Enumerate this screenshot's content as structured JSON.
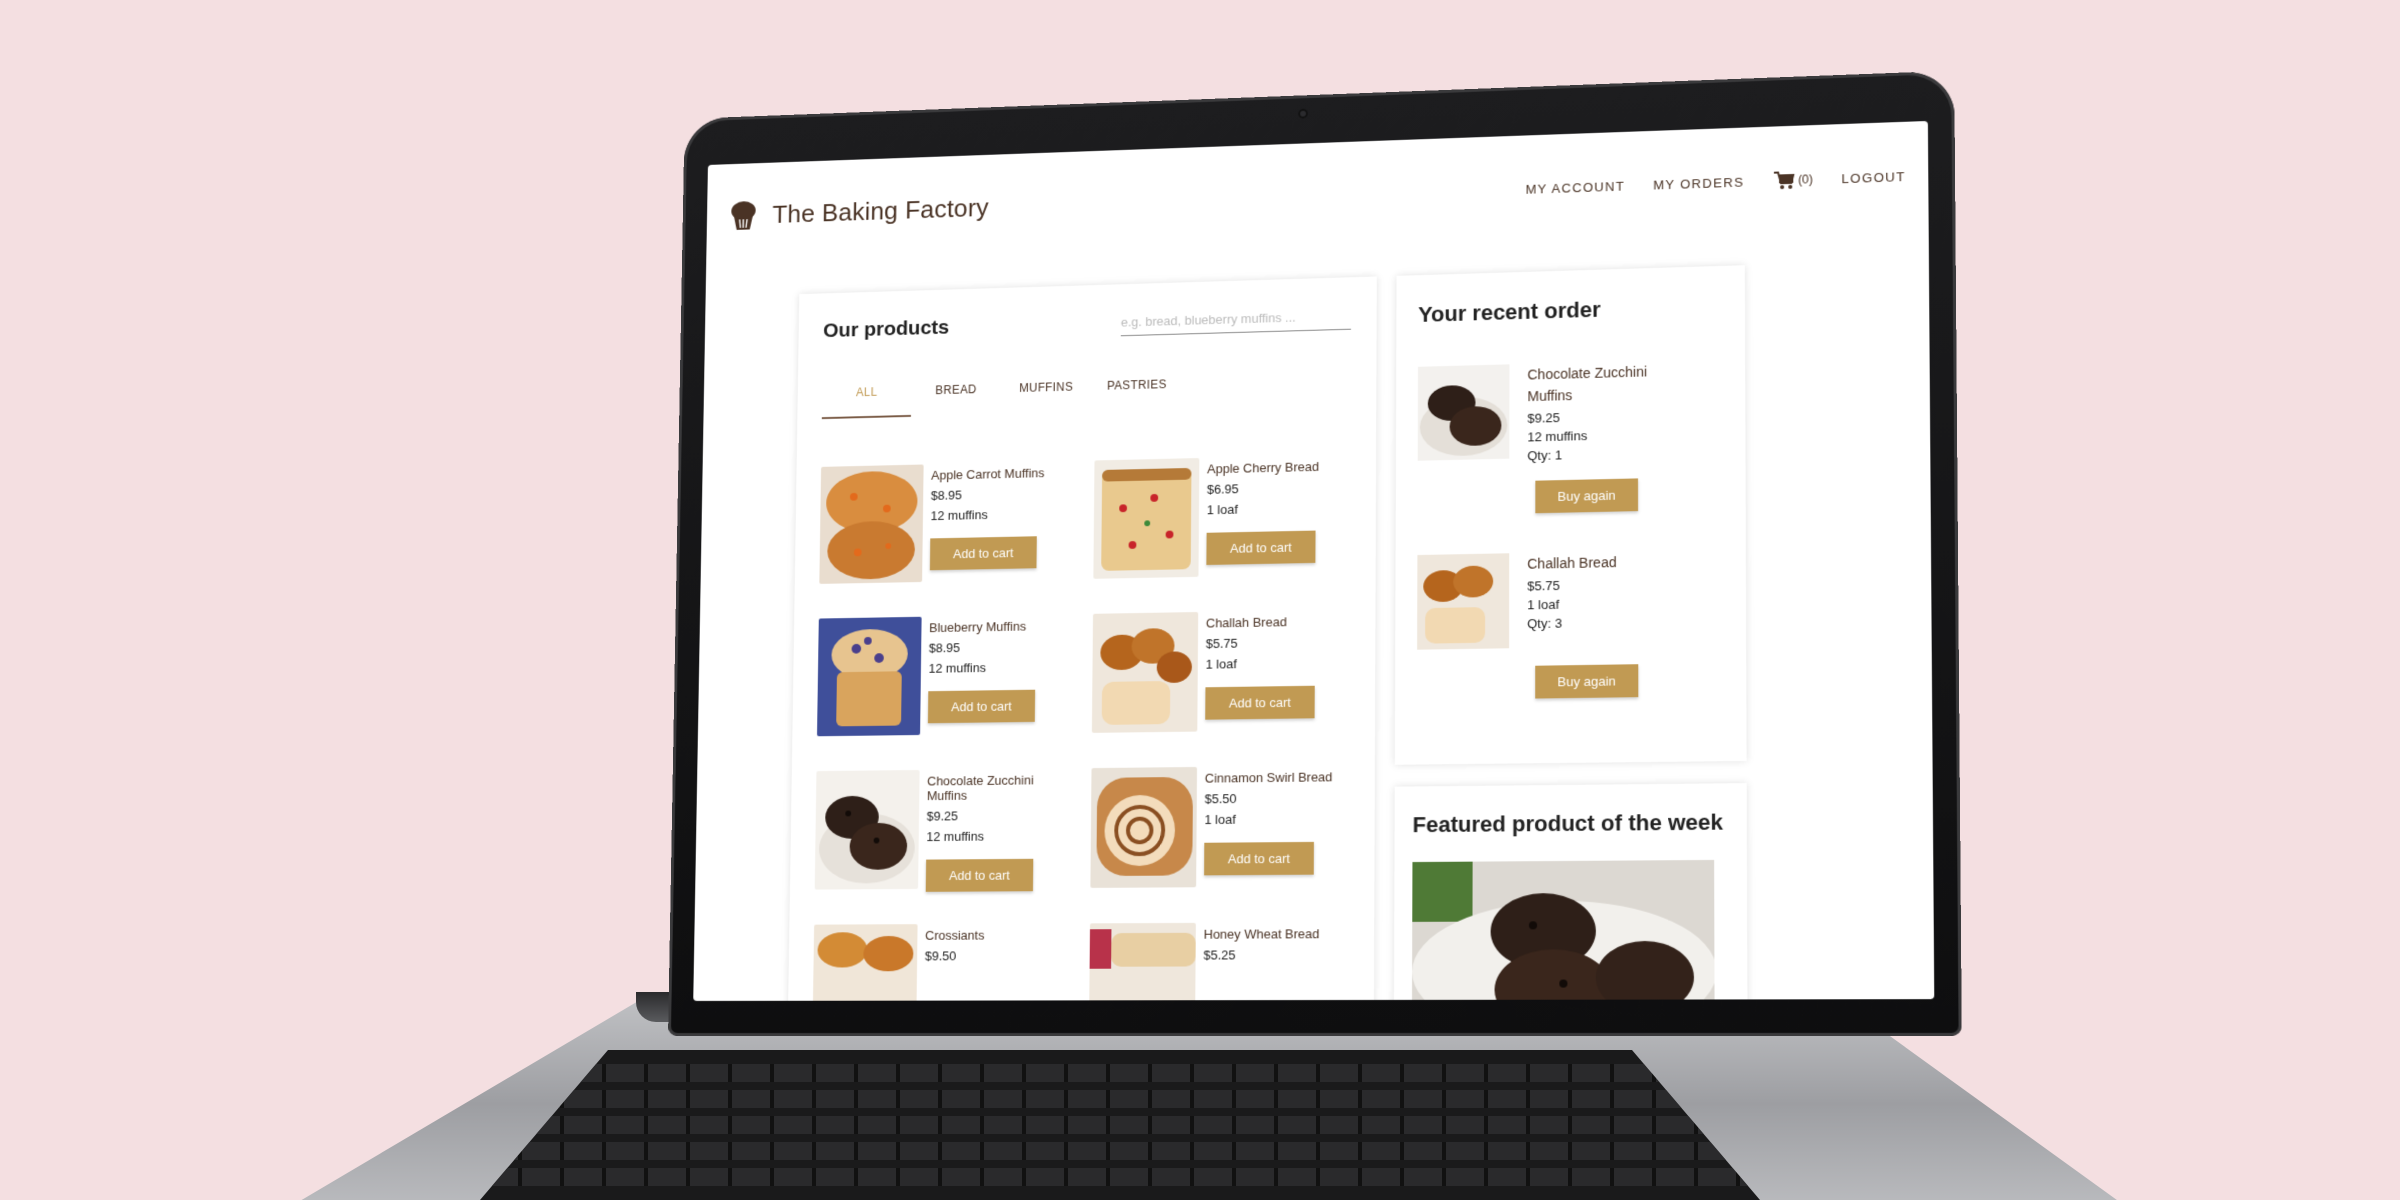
{
  "brand": {
    "name": "The Baking Factory",
    "primary_color": "#4a3325",
    "accent_color": "#c19a53",
    "logo_icon": "muffin-icon"
  },
  "nav": {
    "my_account": "MY ACCOUNT",
    "my_orders": "MY ORDERS",
    "cart_icon": "cart-icon",
    "cart_count": "(0)",
    "logout": "LOGOUT"
  },
  "products": {
    "title": "Our products",
    "search_placeholder": "e.g. bread, blueberry muffins ...",
    "tabs": [
      {
        "label": "ALL",
        "active": true
      },
      {
        "label": "BREAD",
        "active": false
      },
      {
        "label": "MUFFINS",
        "active": false
      },
      {
        "label": "PASTRIES",
        "active": false
      }
    ],
    "items": [
      {
        "name": "Apple Carrot Muffins",
        "price": "$8.95",
        "qty": "12 muffins",
        "button": "Add to cart"
      },
      {
        "name": "Apple Cherry Bread",
        "price": "$6.95",
        "qty": "1 loaf",
        "button": "Add to cart"
      },
      {
        "name": "Blueberry Muffins",
        "price": "$8.95",
        "qty": "12 muffins",
        "button": "Add to cart"
      },
      {
        "name": "Challah Bread",
        "price": "$5.75",
        "qty": "1 loaf",
        "button": "Add to cart"
      },
      {
        "name": "Chocolate Zucchini Muffins",
        "price": "$9.25",
        "qty": "12 muffins",
        "button": "Add to cart"
      },
      {
        "name": "Cinnamon Swirl Bread",
        "price": "$5.50",
        "qty": "1 loaf",
        "button": "Add to cart"
      },
      {
        "name": "Crossiants",
        "price": "$9.50",
        "qty": "",
        "button": ""
      },
      {
        "name": "Honey Wheat Bread",
        "price": "$5.25",
        "qty": "",
        "button": ""
      }
    ]
  },
  "recent_order": {
    "title": "Your recent order",
    "items": [
      {
        "name": "Chocolate Zucchini Muffins",
        "price": "$9.25",
        "size": "12 muffins",
        "qty": "Qty: 1",
        "button": "Buy again"
      },
      {
        "name": "Challah Bread",
        "price": "$5.75",
        "size": "1 loaf",
        "qty": "Qty: 3",
        "button": "Buy again"
      }
    ]
  },
  "featured": {
    "title": "Featured product of the week"
  }
}
